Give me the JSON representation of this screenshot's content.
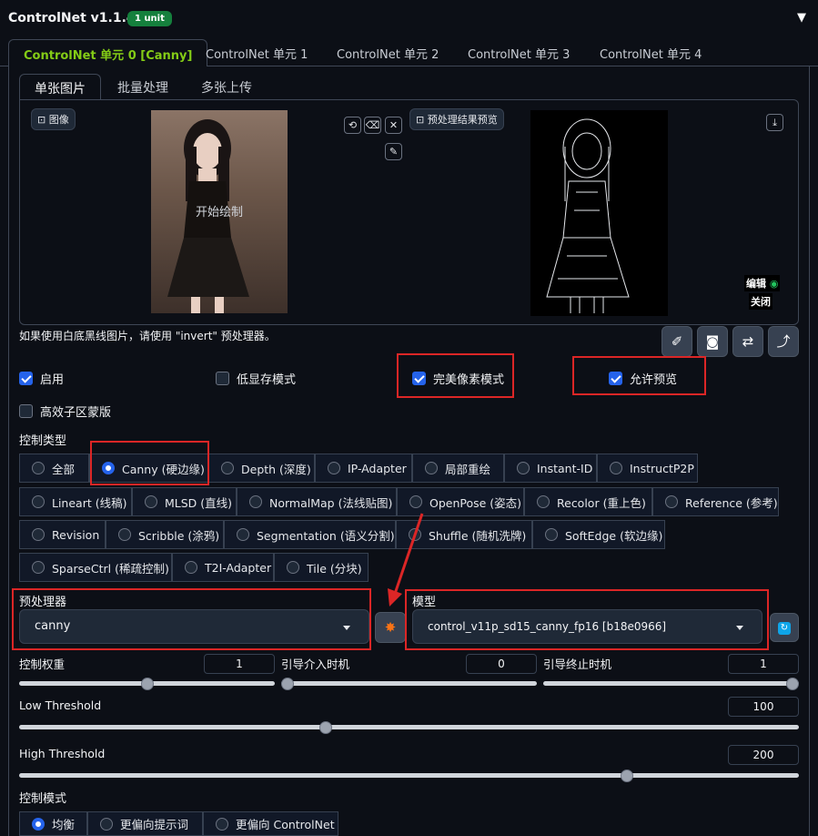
{
  "header": {
    "title": "ControlNet v1.1.455",
    "badge": "1 unit",
    "collapse_glyph": "▼"
  },
  "unit_tabs": [
    "ControlNet 单元 0 [Canny]",
    "ControlNet 单元 1",
    "ControlNet 单元 2",
    "ControlNet 单元 3",
    "ControlNet 单元 4"
  ],
  "input_tabs": [
    "单张图片",
    "批量处理",
    "多张上传"
  ],
  "image_area": {
    "image_label": "图像",
    "start_drawing": "开始绘制",
    "preview_label": "预处理结果预览",
    "edit_label": "编辑",
    "close_label": "关闭"
  },
  "hint": "如果使用白底黑线图片，请使用 \"invert\" 预处理器。",
  "checkboxes": {
    "enable": "启用",
    "low_vram": "低显存模式",
    "pixel_perfect": "完美像素模式",
    "allow_preview": "允许预览",
    "efficient_mask": "高效子区蒙版"
  },
  "control_type": {
    "label": "控制类型",
    "row1": [
      "全部",
      "Canny (硬边缘)",
      "Depth (深度)",
      "IP-Adapter",
      "局部重绘",
      "Instant-ID",
      "InstructP2P"
    ],
    "row2": [
      "Lineart (线稿)",
      "MLSD (直线)",
      "NormalMap (法线贴图)",
      "OpenPose (姿态)",
      "Recolor (重上色)",
      "Reference (参考)"
    ],
    "row3": [
      "Revision",
      "Scribble (涂鸦)",
      "Segmentation (语义分割)",
      "Shuffle (随机洗牌)",
      "SoftEdge (软边缘)"
    ],
    "row4": [
      "SparseCtrl (稀疏控制)",
      "T2I-Adapter",
      "Tile (分块)"
    ],
    "selected": "Canny (硬边缘)"
  },
  "preprocessor": {
    "label": "预处理器",
    "value": "canny"
  },
  "model": {
    "label": "模型",
    "value": "control_v11p_sd15_canny_fp16 [b18e0966]"
  },
  "sliders": {
    "weight": {
      "label": "控制权重",
      "value": "1",
      "fraction": 0.5
    },
    "start": {
      "label": "引导介入时机",
      "value": "0",
      "fraction": 0.0
    },
    "end": {
      "label": "引导终止时机",
      "value": "1",
      "fraction": 1.0
    },
    "low": {
      "label": "Low Threshold",
      "value": "100",
      "fraction": 0.392
    },
    "high": {
      "label": "High Threshold",
      "value": "200",
      "fraction": 0.784
    }
  },
  "control_mode": {
    "label": "控制模式",
    "options": [
      "均衡",
      "更偏向提示词",
      "更偏向 ControlNet"
    ],
    "selected": "均衡"
  },
  "colors": {
    "accent": "#2563eb",
    "active_tab": "#84cc16",
    "highlight": "#dc2626",
    "badge": "#15803d"
  }
}
